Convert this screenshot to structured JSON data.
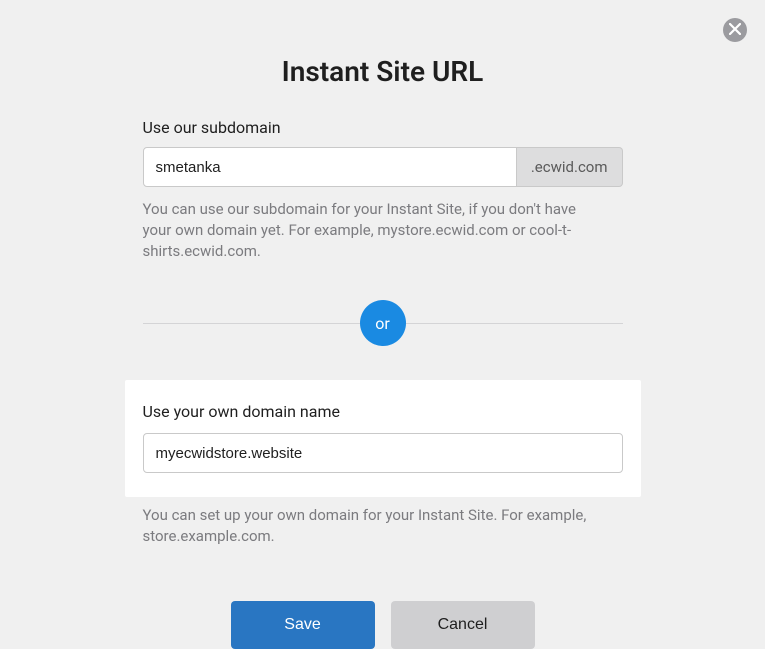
{
  "modal": {
    "title": "Instant Site URL",
    "close_label": "Close"
  },
  "subdomain": {
    "label": "Use our subdomain",
    "value": "smetanka",
    "suffix": ".ecwid.com",
    "help": "You can use our subdomain for your Instant Site, if you don't have your own domain yet. For example, mystore.ecwid.com or cool-t-shirts.ecwid.com."
  },
  "divider": {
    "or_label": "or"
  },
  "own_domain": {
    "label": "Use your own domain name",
    "value": "myecwidstore.website",
    "help": "You can set up your own domain for your Instant Site. For example, store.example.com."
  },
  "buttons": {
    "save": "Save",
    "cancel": "Cancel"
  }
}
